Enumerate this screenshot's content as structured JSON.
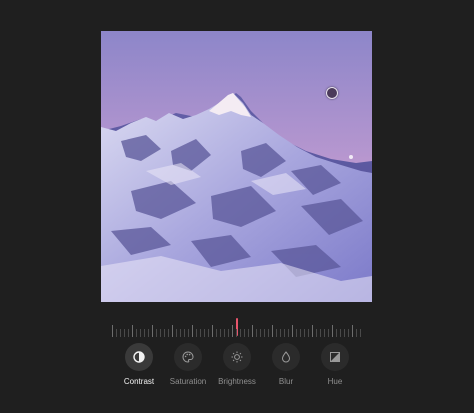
{
  "colors": {
    "background": "#1f1f1f",
    "accent": "#e8556c",
    "active_label": "#f2f2f2",
    "inactive_label": "#8f8f8f"
  },
  "image": {
    "subject": "snow-covered mountain peak at dusk"
  },
  "slider": {
    "value_fraction": 0.5
  },
  "tools": [
    {
      "label": "Contrast",
      "icon": "contrast-icon",
      "active": true
    },
    {
      "label": "Saturation",
      "icon": "palette-icon",
      "active": false
    },
    {
      "label": "Brightness",
      "icon": "brightness-icon",
      "active": false
    },
    {
      "label": "Blur",
      "icon": "droplet-icon",
      "active": false
    },
    {
      "label": "Hue",
      "icon": "hue-icon",
      "active": false
    }
  ]
}
